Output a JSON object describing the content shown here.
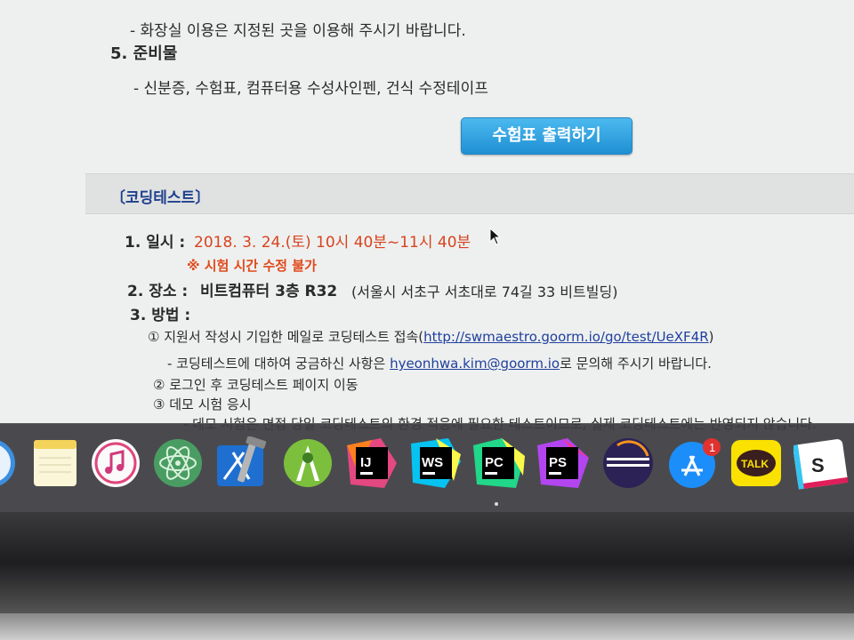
{
  "page": {
    "line_toilet": "- 화장실 이용은 지정된 곳을 이용해 주시기 바랍니다.",
    "prep_heading": "5. 준비물",
    "prep_items": "- 신분증, 수험표, 컴퓨터용 수성사인펜, 건식 수정테이프",
    "print_button": "수험표 출력하기",
    "coding_section_title": "〔코딩테스트〕",
    "date_label": "1. 일시 :",
    "date_value": "2018. 3. 24.(토) 10시 40분~11시 40분",
    "time_note": "※ 시험 시간 수정 불가",
    "place_label": "2. 장소 :",
    "place_value": "비트컴퓨터 3층 R32",
    "place_address": "(서울시 서초구 서초대로 74길 33 비트빌딩)",
    "method_label": "3. 방법 :",
    "step1_text": "① 지원서 작성시 기입한 메일로 코딩테스트 접속(",
    "step1_link": "http://swmaestro.goorm.io/go/test/UeXF4R",
    "step1_close": ")",
    "inquiry_prefix": "- 코딩테스트에 대하여 궁금하신 사항은 ",
    "inquiry_email": "hyeonhwa.kim@goorm.io",
    "inquiry_suffix": "로 문의해 주시기 바랍니다.",
    "step2_text": "② 로그인 후 코딩테스트 페이지 이동",
    "step3_text": "③ 데모 시험 응시",
    "step3_detail": "- 데모 시험은 면접 당일 코딩테스트의 환경 적응에 필요한 테스트이므로, 실제 코딩테스트에는 반영되지 않습니다."
  },
  "dock": {
    "items": [
      {
        "name": "safari-icon"
      },
      {
        "name": "notes-icon"
      },
      {
        "name": "itunes-icon"
      },
      {
        "name": "atom-icon"
      },
      {
        "name": "xcode-icon"
      },
      {
        "name": "android-studio-icon",
        "label": ""
      },
      {
        "name": "intellij-idea-icon",
        "label": "IJ"
      },
      {
        "name": "webstorm-icon",
        "label": "WS"
      },
      {
        "name": "pycharm-icon",
        "label": "PC"
      },
      {
        "name": "phpstorm-icon",
        "label": "PS"
      },
      {
        "name": "eclipse-icon"
      },
      {
        "name": "app-store-icon",
        "badge": "1"
      },
      {
        "name": "kakaotalk-icon",
        "label": "TALK"
      },
      {
        "name": "slack-icon",
        "label": "S"
      }
    ]
  },
  "colors": {
    "accent_red": "#d8431f",
    "link_blue": "#1f3f9e",
    "section_title_blue": "#1f3f8f",
    "button_blue": "#1f8fd2"
  }
}
